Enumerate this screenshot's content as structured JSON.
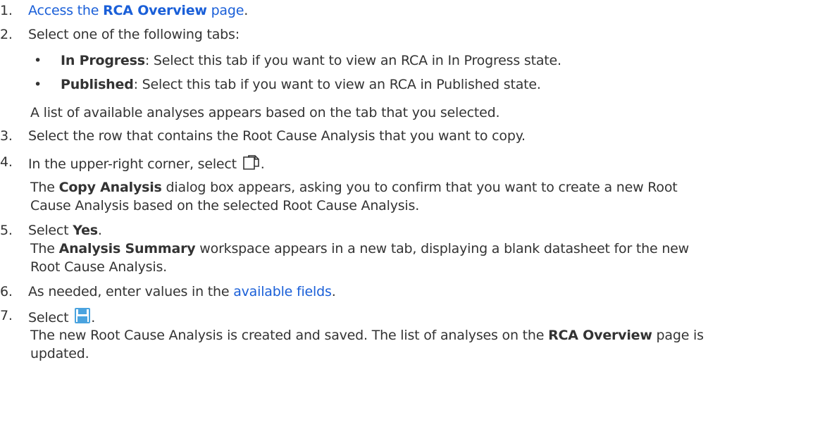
{
  "steps": [
    {
      "num": "1.",
      "pre": "",
      "link_pre": "Access the ",
      "link_bold": "RCA Overview",
      "link_post": " page",
      "post": "."
    },
    {
      "num": "2.",
      "text": "Select one of the following tabs:"
    },
    {
      "num": "3.",
      "text": "Select the row that contains the Root Cause Analysis that you want to copy."
    },
    {
      "num": "4.",
      "pre": "In the upper-right corner, select ",
      "post": "."
    },
    {
      "num": "5.",
      "pre": "Select ",
      "bold": "Yes",
      "post": "."
    },
    {
      "num": "6.",
      "pre": "As needed, enter values in the ",
      "link": "available fields",
      "post": "."
    },
    {
      "num": "7.",
      "pre": "Select ",
      "post": "."
    }
  ],
  "tabs": [
    {
      "bold": "In Progress",
      "text": ": Select this tab if you want to view an RCA in In Progress state."
    },
    {
      "bold": "Published",
      "text": ": Select this tab if you want to view an RCA in Published state."
    }
  ],
  "step2_result": "A list of available analyses appears based on the tab that you selected.",
  "step4_result": {
    "pre": "The ",
    "bold": "Copy Analysis",
    "line1_post": " dialog box appears, asking you to confirm that you want to create a new Root",
    "line2": "Cause Analysis based on the selected Root Cause Analysis."
  },
  "step5_result": {
    "pre": "The ",
    "bold": "Analysis Summary",
    "line1_post": " workspace appears in a new tab, displaying a blank datasheet for the new",
    "line2": "Root Cause Analysis."
  },
  "step7_result": {
    "line1_pre": "The new Root Cause Analysis is created and saved. The list of analyses on the ",
    "bold": "RCA Overview",
    "line1_post": " page is",
    "line2": "updated."
  },
  "icons": {
    "copy": "copy-icon",
    "save": "save-icon",
    "save_color": "#4aa3df"
  },
  "colors": {
    "text": "#333333",
    "link": "#1a5fd8"
  }
}
